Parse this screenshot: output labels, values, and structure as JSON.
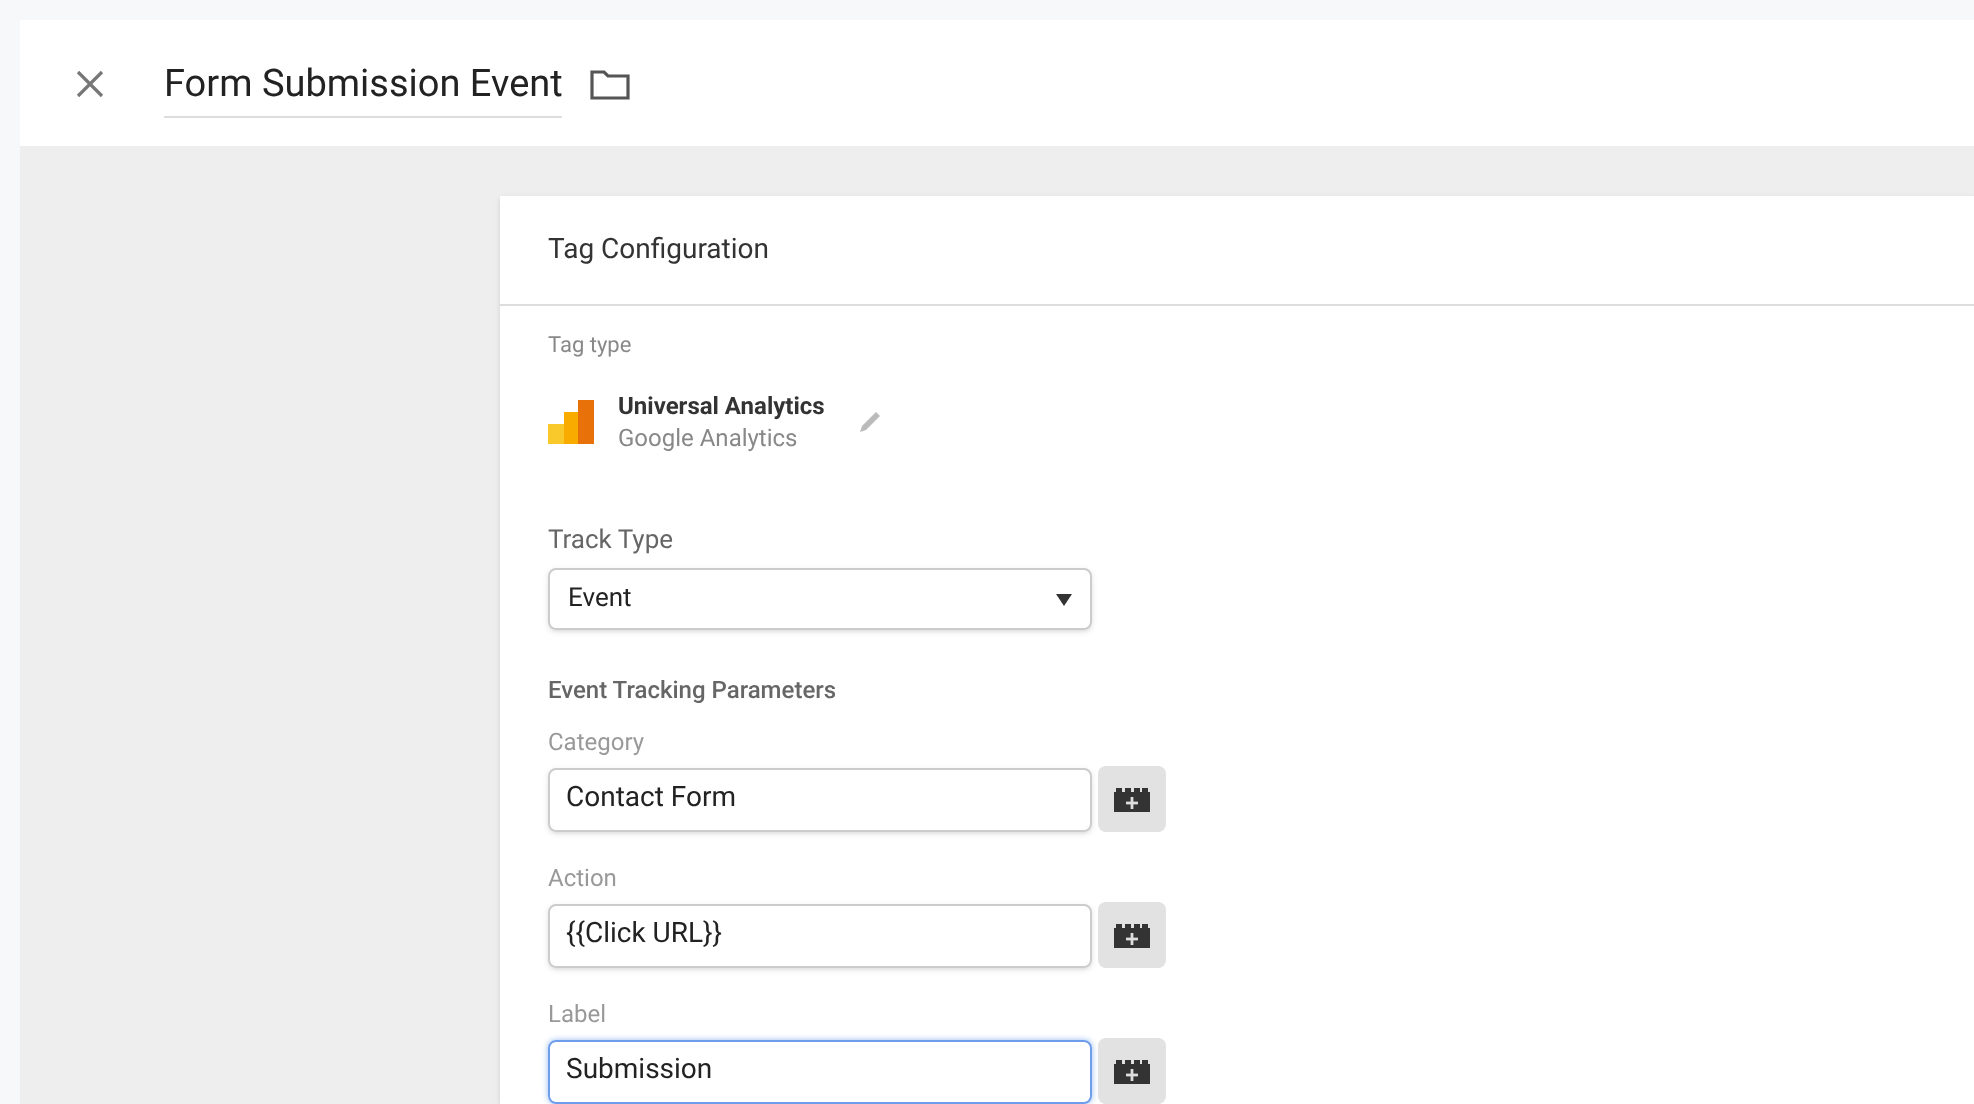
{
  "header": {
    "title": "Form Submission Event"
  },
  "card": {
    "title": "Tag Configuration",
    "tag_type": {
      "label": "Tag type",
      "name": "Universal Analytics",
      "vendor": "Google Analytics"
    },
    "track_type": {
      "label": "Track Type",
      "value": "Event"
    },
    "section": "Event Tracking Parameters",
    "fields": [
      {
        "label": "Category",
        "value": "Contact Form",
        "focused": false
      },
      {
        "label": "Action",
        "value": "{{Click URL}}",
        "focused": false
      },
      {
        "label": "Label",
        "value": "Submission",
        "focused": true
      }
    ]
  }
}
